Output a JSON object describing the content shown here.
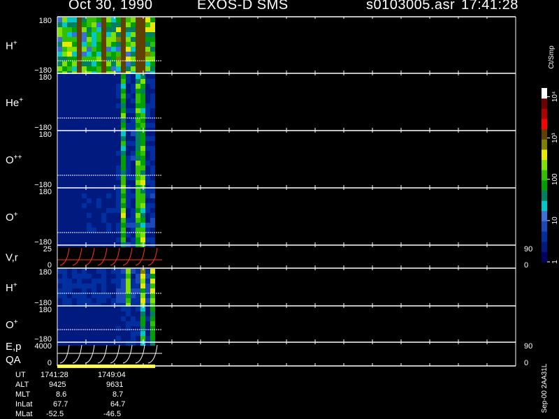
{
  "header": {
    "date": "Oct 30, 1990",
    "mission": "EXOS-D SMS",
    "file": "s0103005.asr",
    "time": "17:41:28"
  },
  "colorbar": {
    "unit": "Ct/Smp",
    "tick_labels": [
      {
        "text": "1",
        "value": 1
      },
      {
        "text": "10",
        "value": 10
      },
      {
        "text": "100",
        "value": 100
      },
      {
        "text": "10³",
        "value": 1000
      },
      {
        "text": "10⁴",
        "value": 10000
      }
    ],
    "colors": [
      "#000066",
      "#001a80",
      "#0030a0",
      "#1c48b8",
      "#3a70d8",
      "#00c8c8",
      "#008060",
      "#00a000",
      "#30c000",
      "#80e000",
      "#e8e800",
      "#808000",
      "#604000",
      "#ff0000",
      "#b00000",
      "#700000",
      "#ffffff"
    ]
  },
  "footer": {
    "version": "Sep-00 2AA31L",
    "ephemeris": [
      {
        "label": "UT",
        "v1": "1741:28",
        "v2": "1749:04"
      },
      {
        "label": "ALT",
        "v1": "9425",
        "v2": "9631"
      },
      {
        "label": "MLT",
        "v1": "8.6",
        "v2": "8.7"
      },
      {
        "label": "InLat",
        "v1": "67.7",
        "v2": "64.7"
      },
      {
        "label": "MLat",
        "v1": "-52.5",
        "v2": "-46.5"
      }
    ]
  },
  "chart_data": {
    "type": "heatmap",
    "panels": [
      {
        "label": "H",
        "sup": "+",
        "ymax": "180",
        "ymin": "−180",
        "level": 2.1,
        "bands": [
          0.2,
          0.45,
          0.65,
          0.82
        ]
      },
      {
        "label": "He",
        "sup": "+",
        "ymax": "180",
        "ymin": "−180",
        "level": 0.25,
        "bands": [
          0.65,
          0.82
        ]
      },
      {
        "label": "O",
        "sup": "++",
        "ymax": "180",
        "ymin": "−180",
        "level": 0.3,
        "bands": [
          0.65,
          0.82
        ]
      },
      {
        "label": "O",
        "sup": "+",
        "ymax": "180",
        "ymin": "−180",
        "level": 0.35,
        "bands": [
          0.65,
          0.82
        ]
      },
      {
        "label": "V,r",
        "sup": "",
        "ymax": "25",
        "ymin": "0",
        "right_top": "90",
        "right_bottom": "0",
        "line": true
      },
      {
        "label": "H",
        "sup": "+",
        "ymax": "180",
        "ymin": "−180",
        "level": 0.5,
        "bands": [
          0.7,
          0.85,
          0.95
        ]
      },
      {
        "label": "O",
        "sup": "+",
        "ymax": "180",
        "ymin": "−180",
        "level": 0.2,
        "bands": [
          0.85,
          0.95
        ]
      },
      {
        "label": "E,p",
        "label2": "QA",
        "sup": "",
        "ymax": "4000",
        "ymin": "0",
        "right_top": "90",
        "right_bottom": "0",
        "line": true
      }
    ]
  }
}
